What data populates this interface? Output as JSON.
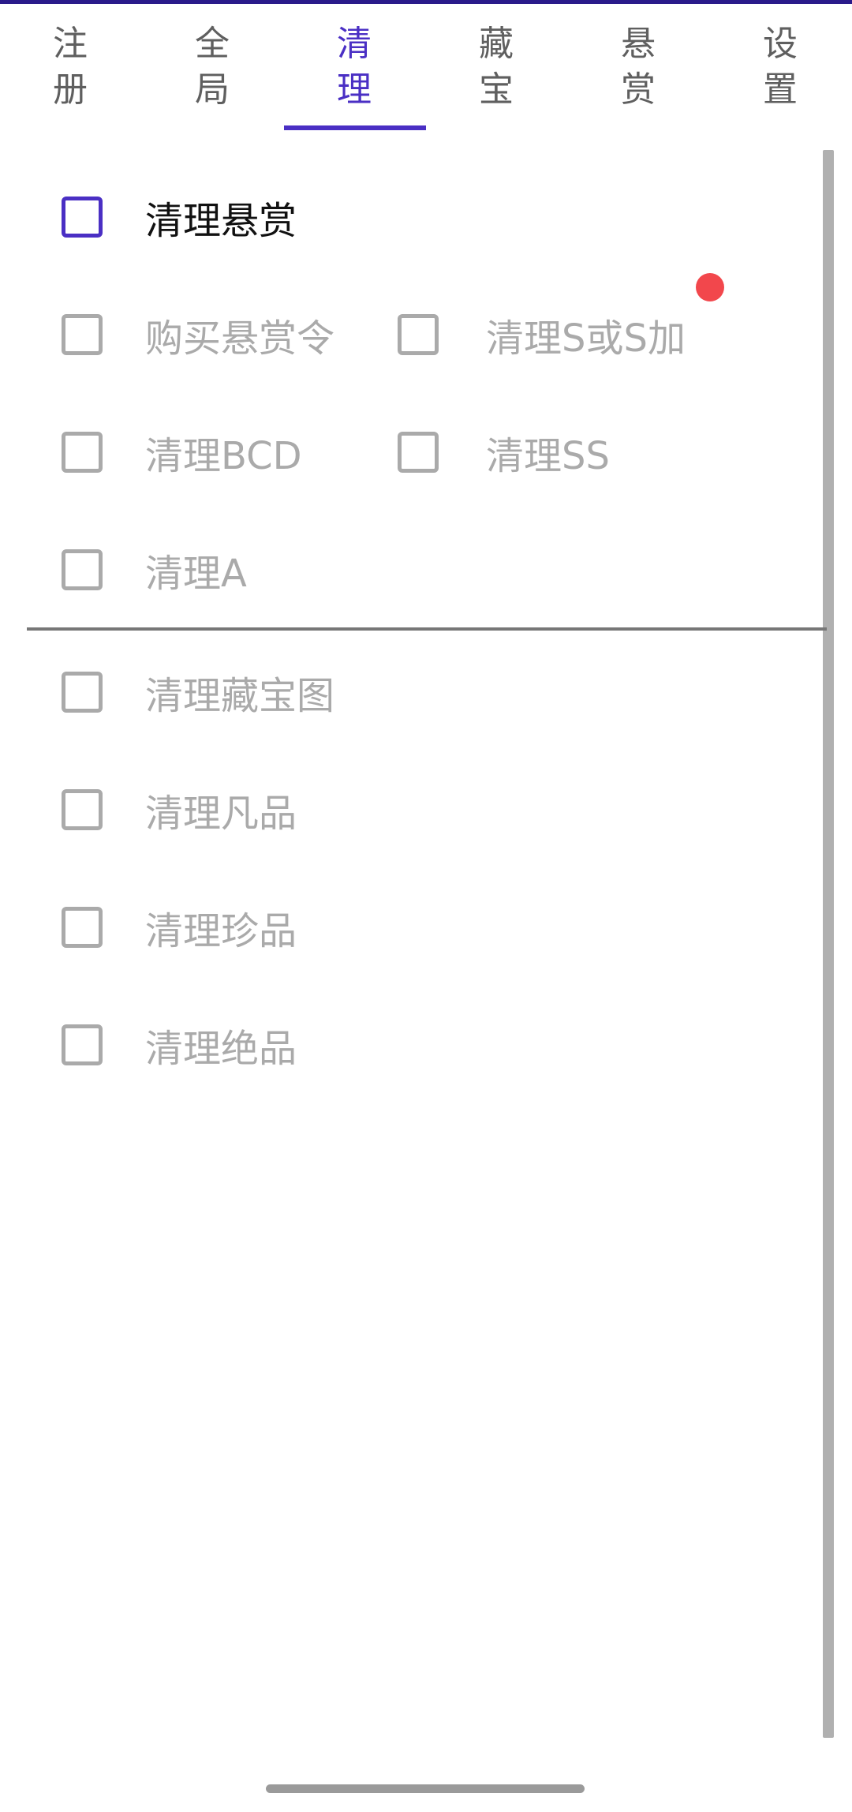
{
  "tabs": [
    {
      "label": "注册",
      "active": false
    },
    {
      "label": "全局",
      "active": false
    },
    {
      "label": "清理",
      "active": true
    },
    {
      "label": "藏宝",
      "active": false
    },
    {
      "label": "悬赏",
      "active": false
    },
    {
      "label": "设置",
      "active": false
    }
  ],
  "options": {
    "clean_bounty": "清理悬赏",
    "buy_bounty_order": "购买悬赏令",
    "clean_s_or_s_plus": "清理S或S加",
    "clean_bcd": "清理BCD",
    "clean_ss": "清理SS",
    "clean_a": "清理A",
    "clean_treasure_map": "清理藏宝图",
    "clean_common": "清理凡品",
    "clean_rare": "清理珍品",
    "clean_legendary": "清理绝品"
  },
  "colors": {
    "accent": "#4a2fc4",
    "disabled": "#aaaaaa",
    "notification_dot": "#f2474c"
  }
}
